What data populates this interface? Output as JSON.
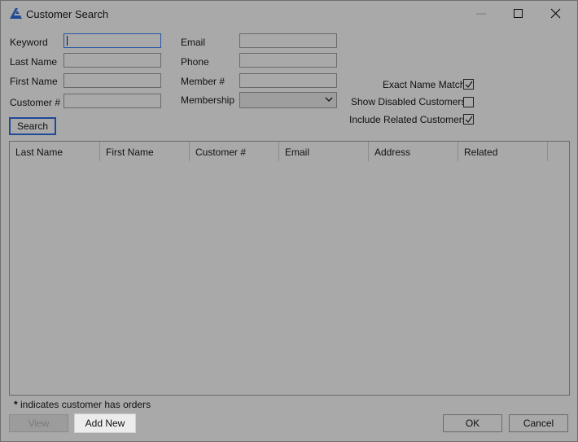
{
  "window": {
    "title": "Customer Search",
    "controls": [
      "minimize",
      "maximize",
      "close"
    ]
  },
  "form": {
    "keyword_label": "Keyword",
    "keyword_value": "",
    "last_name_label": "Last Name",
    "last_name_value": "",
    "first_name_label": "First Name",
    "first_name_value": "",
    "customer_no_label": "Customer #",
    "customer_no_value": "",
    "email_label": "Email",
    "email_value": "",
    "phone_label": "Phone",
    "phone_value": "",
    "member_no_label": "Member #",
    "member_no_value": "",
    "membership_label": "Membership",
    "membership_value": "",
    "search_button": "Search"
  },
  "options": {
    "exact_name_match": {
      "label": "Exact Name Match",
      "checked": true
    },
    "show_disabled_customers": {
      "label": "Show Disabled Customers",
      "checked": false
    },
    "include_related_customers": {
      "label": "Include Related Customers",
      "checked": true
    }
  },
  "grid": {
    "columns": [
      "Last Name",
      "First Name",
      "Customer #",
      "Email",
      "Address",
      "Related"
    ],
    "rows": []
  },
  "footer": {
    "note_star": "*",
    "note_text": " indicates customer has orders",
    "view_button": "View",
    "add_new_button": "Add New",
    "ok_button": "OK",
    "cancel_button": "Cancel"
  },
  "colors": {
    "background": "#a9a9a9",
    "focus_border": "#2456a8",
    "primary_border": "#1f4a94",
    "app_icon": "#1f4a94"
  }
}
